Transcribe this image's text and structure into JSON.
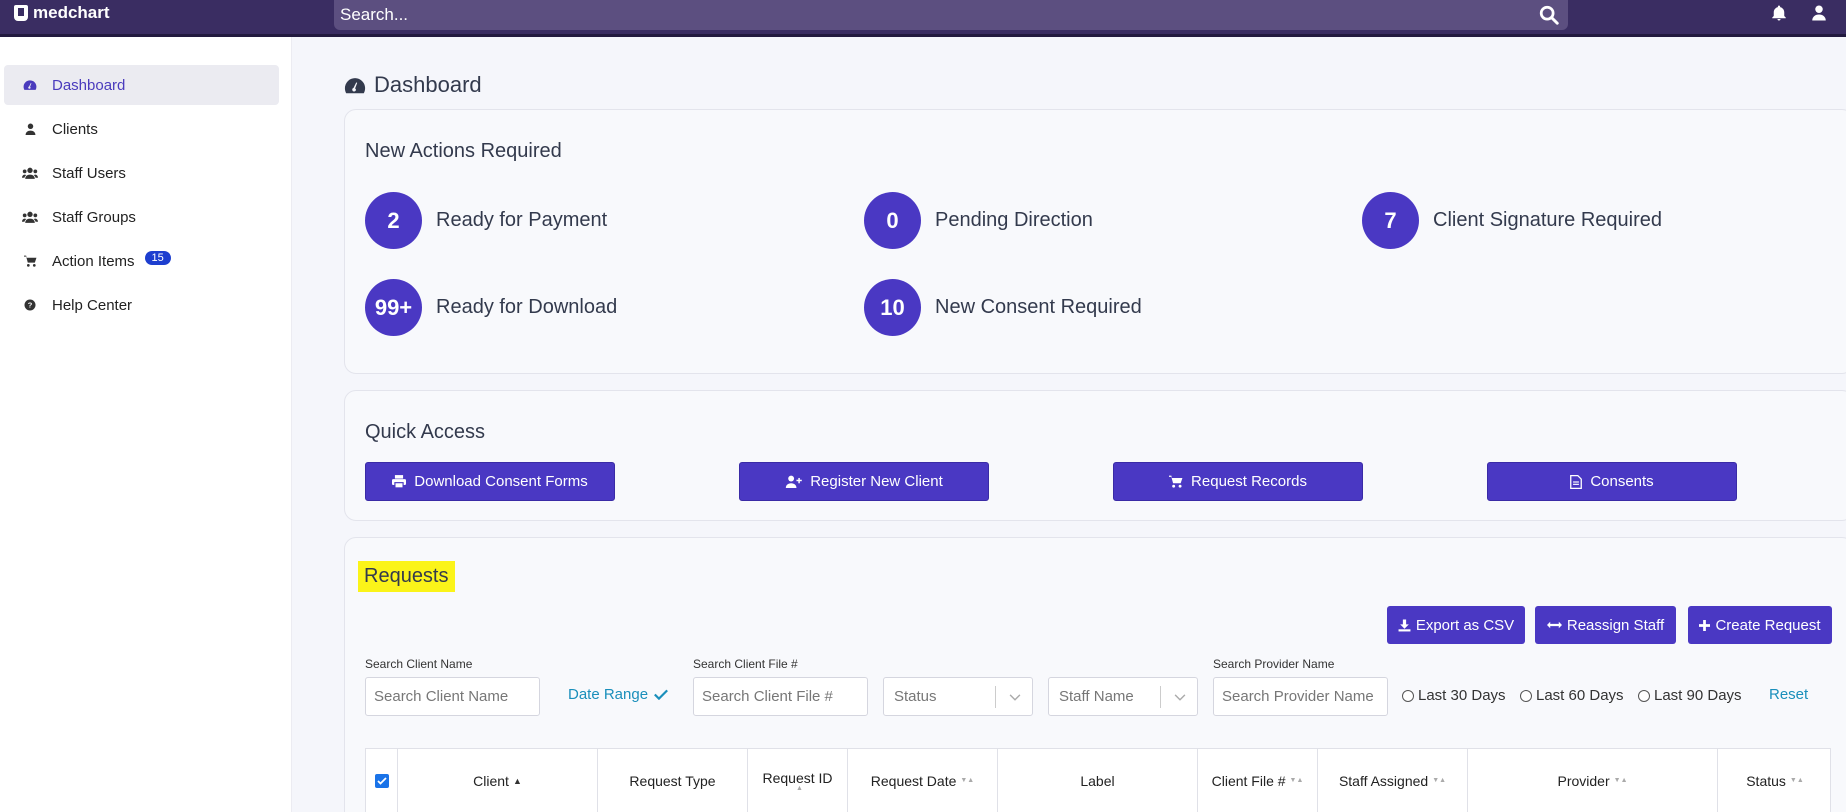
{
  "app": {
    "logo_text": "medchart"
  },
  "search": {
    "placeholder": "Search..."
  },
  "sidebar": {
    "items": [
      {
        "label": "Dashboard",
        "icon": "tachometer-icon",
        "active": true
      },
      {
        "label": "Clients",
        "icon": "user-icon"
      },
      {
        "label": "Staff Users",
        "icon": "users-icon"
      },
      {
        "label": "Staff Groups",
        "icon": "users-icon"
      },
      {
        "label": "Action Items",
        "icon": "cart-icon",
        "badge": "15"
      },
      {
        "label": "Help Center",
        "icon": "question-circle-icon"
      }
    ]
  },
  "page": {
    "title": "Dashboard"
  },
  "actions": {
    "title": "New Actions Required",
    "items": [
      {
        "count": "2",
        "label": "Ready for Payment"
      },
      {
        "count": "0",
        "label": "Pending Direction"
      },
      {
        "count": "7",
        "label": "Client Signature Required"
      },
      {
        "count": "99+",
        "label": "Ready for Download"
      },
      {
        "count": "10",
        "label": "New Consent Required"
      }
    ]
  },
  "quick_access": {
    "title": "Quick Access",
    "buttons": [
      {
        "label": "Download Consent Forms",
        "icon": "print-icon"
      },
      {
        "label": "Register New Client",
        "icon": "user-plus-icon"
      },
      {
        "label": "Request Records",
        "icon": "cart-icon"
      },
      {
        "label": "Consents",
        "icon": "file-icon"
      }
    ]
  },
  "requests": {
    "title": "Requests",
    "toolbar": {
      "export_label": "Export as CSV",
      "reassign_label": "Reassign Staff",
      "create_label": "Create Request"
    },
    "filters": {
      "client_name_label": "Search Client Name",
      "client_name_placeholder": "Search Client Name",
      "date_range_label": "Date Range",
      "client_file_label": "Search Client File #",
      "client_file_placeholder": "Search Client File #",
      "status_placeholder": "Status",
      "staff_placeholder": "Staff Name",
      "provider_label": "Search Provider Name",
      "provider_placeholder": "Search Provider Name",
      "radio_30": "Last 30 Days",
      "radio_60": "Last 60 Days",
      "radio_90": "Last 90 Days",
      "reset_label": "Reset"
    },
    "columns": [
      "Client",
      "Request Type",
      "Request ID",
      "Request Date",
      "Label",
      "Client File #",
      "Staff Assigned",
      "Provider",
      "Status"
    ]
  },
  "colors": {
    "primary": "#4a38c3",
    "topbar": "#3a2d62",
    "highlight": "#fbf419",
    "link": "#1a8fbb"
  }
}
